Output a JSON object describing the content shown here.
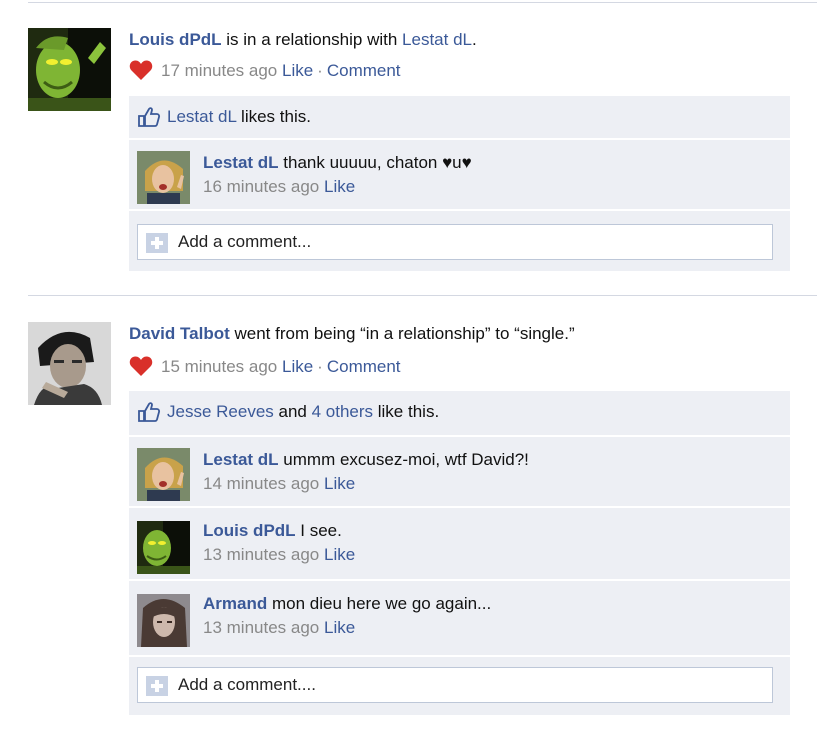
{
  "story1": {
    "author": "Louis dPdL",
    "verb": " is in a relationship with ",
    "target": "Lestat dL",
    "end": ".",
    "time": "17 minutes ago",
    "like": "Like",
    "separator": "·",
    "comment": "Comment",
    "likes": {
      "name": "Lestat dL",
      "text": " likes this."
    },
    "comments": [
      {
        "author": "Lestat dL",
        "text": "thank uuuuu, chaton ♥u♥",
        "time": "16 minutes ago",
        "like": "Like"
      }
    ],
    "add_comment": "Add a comment..."
  },
  "story2": {
    "author": "David Talbot",
    "verb": " went from being “in a relationship” to “single.”",
    "time": "15 minutes ago",
    "like": "Like",
    "separator": "·",
    "comment": "Comment",
    "likes": {
      "name": "Jesse Reeves",
      "and": " and ",
      "others": "4 others",
      "text": " like this."
    },
    "comments": [
      {
        "author": "Lestat dL",
        "text": "ummm excusez-moi, wtf David?!",
        "time": "14 minutes ago",
        "like": "Like"
      },
      {
        "author": "Louis dPdL",
        "text": "I see.",
        "time": "13 minutes ago",
        "like": "Like"
      },
      {
        "author": "Armand",
        "text": "mon dieu here we go again...",
        "time": "13 minutes ago",
        "like": "Like"
      }
    ],
    "add_comment": "Add a comment...."
  },
  "colors": {
    "link": "#3b5998",
    "ufi_bg": "#edeff4",
    "meta": "#888888",
    "heart": "#d9302a"
  },
  "icons": {
    "heart": "heart-icon",
    "thumb": "thumbs-up-icon",
    "add": "plus-icon"
  }
}
